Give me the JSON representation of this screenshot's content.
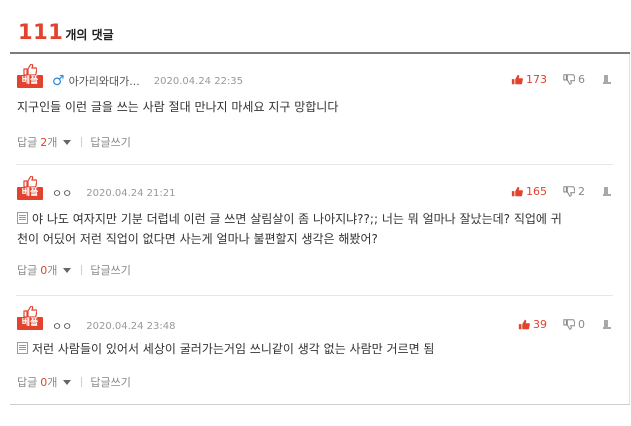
{
  "header": {
    "count": "111",
    "label": "개의 댓글"
  },
  "best_label": "베플",
  "reply_label": "답글",
  "reply_unit": "개",
  "write_label": "답글쓰기",
  "comments": [
    {
      "gender_icon": "♂",
      "nickname": "아가리와대가...",
      "date": "2020.04.24 22:35",
      "text": "지구인들 이런 글을 쓰는 사람 절대 만나지 마세요 지구 망합니다",
      "likes": "173",
      "dislikes": "6",
      "replies": "2"
    },
    {
      "nickname": "ㅇㅇ",
      "date": "2020.04.24 21:21",
      "text_line1": "야 나도 여자지만 기분 더럽네 이런 글 쓰면 살림살이 좀 나아지냐??;; 너는 뭐 얼마나 잘났는데? 직업에 귀",
      "text_line2": "천이 어딨어 저런 직업이 없다면 사는게 얼마나 불편할지 생각은 해봤어?",
      "likes": "165",
      "dislikes": "2",
      "replies": "0"
    },
    {
      "nickname": "ㅇㅇ",
      "date": "2020.04.24 23:48",
      "text": "저런 사람들이 있어서 세상이 굴러가는거임 쓰니같이 생각 없는 사람만 거르면 됨",
      "likes": "39",
      "dislikes": "0",
      "replies": "0"
    }
  ],
  "colors": {
    "accent": "#e2422e",
    "male": "#2b8ad8"
  }
}
